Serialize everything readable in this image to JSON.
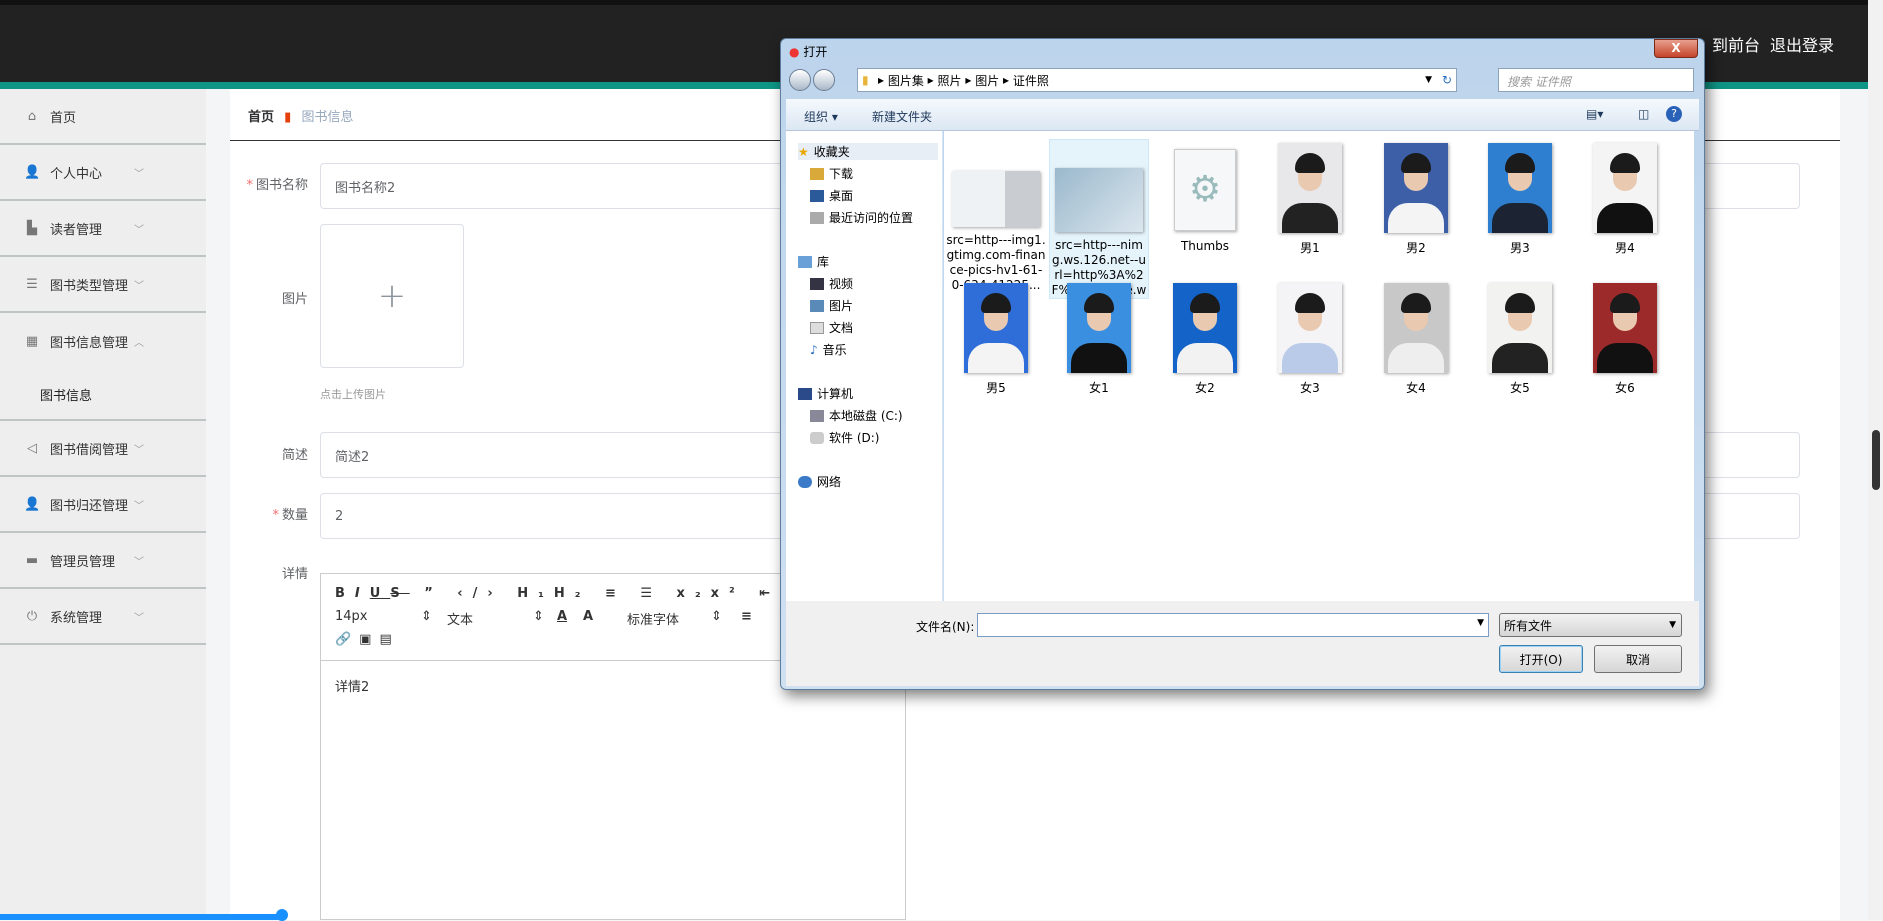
{
  "header": {
    "to_front": "到前台",
    "logout": "退出登录"
  },
  "sidebar": {
    "items": [
      {
        "label": "首页",
        "icon": "home-icon",
        "glyph": "⌂"
      },
      {
        "label": "个人中心",
        "icon": "user-icon",
        "glyph": "👤"
      },
      {
        "label": "读者管理",
        "icon": "reader-icon",
        "glyph": "▙"
      },
      {
        "label": "图书类型管理",
        "icon": "sliders-icon",
        "glyph": "☰"
      },
      {
        "label": "图书信息管理",
        "icon": "grid-icon",
        "glyph": "▦",
        "sub": "图书信息"
      },
      {
        "label": "图书借阅管理",
        "icon": "send-icon",
        "glyph": "◁"
      },
      {
        "label": "图书归还管理",
        "icon": "user-icon",
        "glyph": "👤"
      },
      {
        "label": "管理员管理",
        "icon": "briefcase-icon",
        "glyph": "▬"
      },
      {
        "label": "系统管理",
        "icon": "power-icon",
        "glyph": "⏻"
      }
    ]
  },
  "breadcrumb": {
    "home": "首页",
    "current": "图书信息"
  },
  "form": {
    "name_label": "图书名称",
    "name_value": "图书名称2",
    "image_label": "图片",
    "upload_hint": "点击上传图片",
    "desc_label": "简述",
    "desc_value": "简述2",
    "qty_label": "数量",
    "qty_value": "2",
    "detail_label": "详情",
    "detail_value": "详情2",
    "editor": {
      "font_size": "14px",
      "heading": "文本",
      "font_family": "标准字体"
    }
  },
  "dialog": {
    "title": "打开",
    "close": "X",
    "path": [
      "图片集",
      "照片",
      "图片",
      "证件照"
    ],
    "search_placeholder": "搜索 证件照",
    "organize": "组织 ▾",
    "new_folder": "新建文件夹",
    "nav": {
      "favorites": "收藏夹",
      "downloads": "下载",
      "desktop": "桌面",
      "recent": "最近访问的位置",
      "libraries": "库",
      "videos": "视频",
      "pictures": "图片",
      "documents": "文档",
      "music": "音乐",
      "computer": "计算机",
      "drive_c": "本地磁盘 (C:)",
      "drive_d": "软件 (D:)",
      "network": "网络"
    },
    "files": [
      {
        "name": "src=http---img1.gtimg.com-finance-pics-hv1-61-0-634-41225...",
        "kind": "idcard"
      },
      {
        "name": "src=http---nimg.ws.126.net--url=http%3A%2F%2Fdingyue.ws....",
        "kind": "idcard2"
      },
      {
        "name": "Thumbs",
        "kind": "system"
      },
      {
        "name": "男1",
        "bg": "#e8e8ea",
        "cloth": "#222"
      },
      {
        "name": "男2",
        "bg": "#3d5fa8",
        "cloth": "#f4f4f4"
      },
      {
        "name": "男3",
        "bg": "#2f7fd0",
        "cloth": "#1c2333"
      },
      {
        "name": "男4",
        "bg": "#f4f4f4",
        "cloth": "#111"
      },
      {
        "name": "男5",
        "bg": "#2f6ed8",
        "cloth": "#f4f4f4"
      },
      {
        "name": "女1",
        "bg": "#3a8fe0",
        "cloth": "#111"
      },
      {
        "name": "女2",
        "bg": "#1463c8",
        "cloth": "#f2f2f2"
      },
      {
        "name": "女3",
        "bg": "#f4f4f6",
        "cloth": "#b9cbe8"
      },
      {
        "name": "女4",
        "bg": "#c8c8c8",
        "cloth": "#eee"
      },
      {
        "name": "女5",
        "bg": "#f2f2f0",
        "cloth": "#222"
      },
      {
        "name": "女6",
        "bg": "#9c2a2a",
        "cloth": "#111"
      }
    ],
    "filename_label": "文件名(N):",
    "filename_value": "",
    "filter": "所有文件",
    "open": "打开(O)",
    "cancel": "取消"
  }
}
